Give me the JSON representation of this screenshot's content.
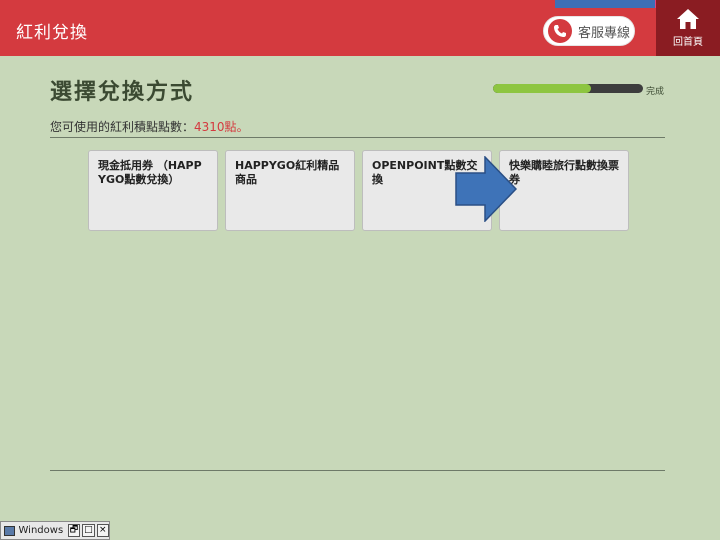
{
  "header": {
    "title": "紅利兌換",
    "service_label": "客服專線",
    "home_label": "回首頁",
    "accent_color": "#d43a3f"
  },
  "main": {
    "title": "選擇兌換方式",
    "progress": {
      "label": "完成",
      "fraction": 0.65
    },
    "points_prefix": "您可使用的紅利積點點數：",
    "points_value": "4310點",
    "points_suffix": "。",
    "options": [
      {
        "label": "現金抵用券 （HAPPYGO點數兌換）"
      },
      {
        "label": "HAPPYGO紅利精品商品"
      },
      {
        "label": "OPENPOINT點數交換"
      },
      {
        "label": "快樂購睦旅行點數換票券"
      }
    ],
    "arrow_color": "#3e73b8"
  },
  "taskbar": {
    "label": "Windows ...",
    "restore": "🗗",
    "maximize": "□",
    "close": "×"
  }
}
